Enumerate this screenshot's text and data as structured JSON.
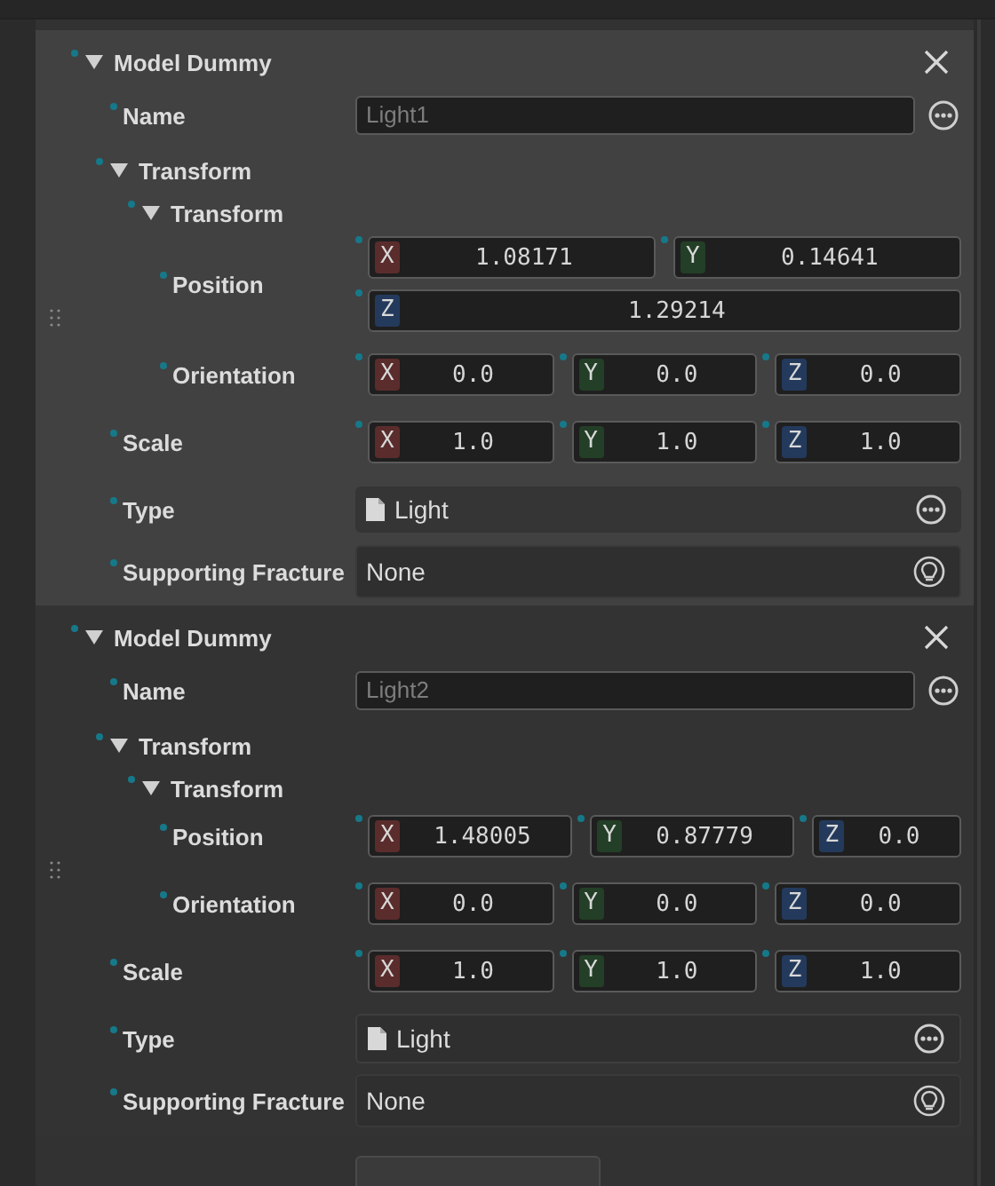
{
  "dummies": [
    {
      "title": "Model Dummy",
      "expanded": true,
      "selected": true,
      "name": {
        "label": "Name",
        "placeholder": "Light1"
      },
      "transform": {
        "label": "Transform",
        "expanded": true,
        "inner": {
          "label": "Transform",
          "expanded": true,
          "position": {
            "label": "Position",
            "kind": "wrapped",
            "axes": [
              {
                "axis": "X",
                "value": "1.08171"
              },
              {
                "axis": "Y",
                "value": "0.14641"
              },
              {
                "axis": "Z",
                "value": "1.29214"
              }
            ]
          },
          "orientation": {
            "label": "Orientation",
            "kind": "row",
            "axes": [
              {
                "axis": "X",
                "value": "0.0"
              },
              {
                "axis": "Y",
                "value": "0.0"
              },
              {
                "axis": "Z",
                "value": "0.0"
              }
            ]
          }
        }
      },
      "scale": {
        "label": "Scale",
        "kind": "row",
        "axes": [
          {
            "axis": "X",
            "value": "1.0"
          },
          {
            "axis": "Y",
            "value": "1.0"
          },
          {
            "axis": "Z",
            "value": "1.0"
          }
        ]
      },
      "type": {
        "label": "Type",
        "value": "Light"
      },
      "supporting_fracture": {
        "label": "Supporting Fracture",
        "value": "None"
      }
    },
    {
      "title": "Model Dummy",
      "expanded": true,
      "selected": false,
      "name": {
        "label": "Name",
        "placeholder": "Light2"
      },
      "transform": {
        "label": "Transform",
        "expanded": true,
        "inner": {
          "label": "Transform",
          "expanded": true,
          "position": {
            "label": "Position",
            "kind": "row",
            "axes": [
              {
                "axis": "X",
                "value": "1.48005"
              },
              {
                "axis": "Y",
                "value": "0.87779"
              },
              {
                "axis": "Z",
                "value": "0.0"
              }
            ]
          },
          "orientation": {
            "label": "Orientation",
            "kind": "row",
            "axes": [
              {
                "axis": "X",
                "value": "0.0"
              },
              {
                "axis": "Y",
                "value": "0.0"
              },
              {
                "axis": "Z",
                "value": "0.0"
              }
            ]
          }
        }
      },
      "scale": {
        "label": "Scale",
        "kind": "row",
        "axes": [
          {
            "axis": "X",
            "value": "1.0"
          },
          {
            "axis": "Y",
            "value": "1.0"
          },
          {
            "axis": "Z",
            "value": "1.0"
          }
        ]
      },
      "type": {
        "label": "Type",
        "value": "Light"
      },
      "supporting_fracture": {
        "label": "Supporting Fracture",
        "value": "None"
      }
    }
  ]
}
